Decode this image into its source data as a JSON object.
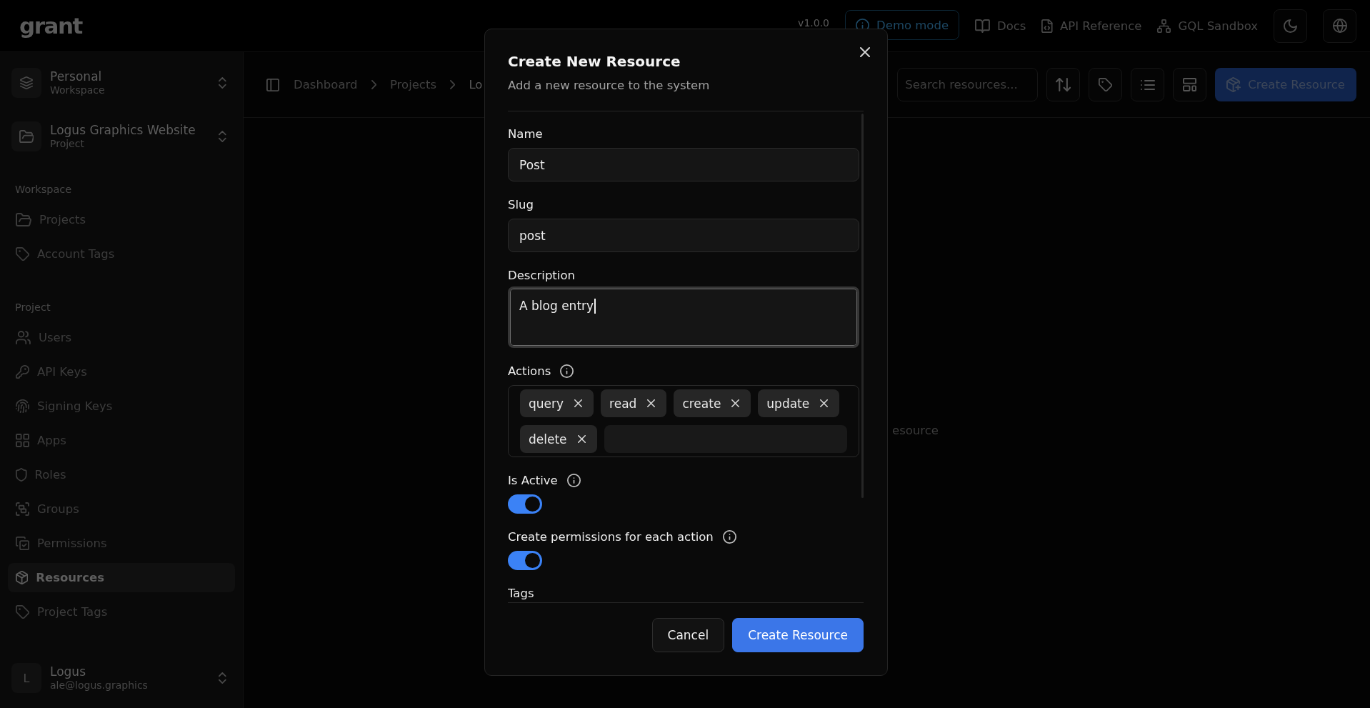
{
  "header": {
    "logo": "grant",
    "version": "v1.0.0",
    "demo_button": "Demo mode",
    "links": [
      "Docs",
      "API Reference",
      "GQL Sandbox"
    ]
  },
  "sidebar": {
    "switchers": [
      {
        "title": "Personal",
        "subtitle": "Workspace"
      },
      {
        "title": "Logus Graphics Website",
        "subtitle": "Project"
      }
    ],
    "sections": [
      {
        "label": "Workspace",
        "items": [
          {
            "label": "Projects",
            "selected": false
          },
          {
            "label": "Account Tags",
            "selected": false
          }
        ]
      },
      {
        "label": "Project",
        "items": [
          {
            "label": "Users",
            "selected": false
          },
          {
            "label": "API Keys",
            "selected": false
          },
          {
            "label": "Signing Keys",
            "selected": false
          },
          {
            "label": "Apps",
            "selected": false
          },
          {
            "label": "Roles",
            "selected": false
          },
          {
            "label": "Groups",
            "selected": false
          },
          {
            "label": "Permissions",
            "selected": false
          },
          {
            "label": "Resources",
            "selected": true
          },
          {
            "label": "Project Tags",
            "selected": false
          }
        ]
      }
    ],
    "user": {
      "initial": "L",
      "name": "Logus",
      "email": "ale@logus.graphics"
    }
  },
  "main": {
    "breadcrumb": [
      "Dashboard",
      "Projects",
      "Lo"
    ],
    "search": {
      "placeholder": "Search resources..."
    },
    "create_button": "Create Resource",
    "empty_state": "esource"
  },
  "dialog": {
    "title": "Create New Resource",
    "subtitle": "Add a new resource to the system",
    "fields": [
      {
        "kind": "text",
        "label": "Name",
        "info": false,
        "value": "Post",
        "focused": false
      },
      {
        "kind": "text",
        "label": "Slug",
        "info": false,
        "value": "post",
        "focused": false
      },
      {
        "kind": "textarea",
        "label": "Description",
        "info": false,
        "value": "A blog entry",
        "focused": true
      },
      {
        "kind": "tags",
        "label": "Actions",
        "info": true,
        "tags": [
          "query",
          "read",
          "create",
          "update",
          "delete"
        ]
      },
      {
        "kind": "toggle",
        "label": "Is Active",
        "info": true,
        "on": true
      },
      {
        "kind": "toggle",
        "label": "Create permissions for each action",
        "info": true,
        "on": true
      },
      {
        "kind": "label",
        "label": "Tags",
        "info": false
      }
    ],
    "buttons": [
      {
        "label": "Cancel",
        "kind": "secondary"
      },
      {
        "label": "Create Resource",
        "kind": "primary"
      }
    ]
  }
}
